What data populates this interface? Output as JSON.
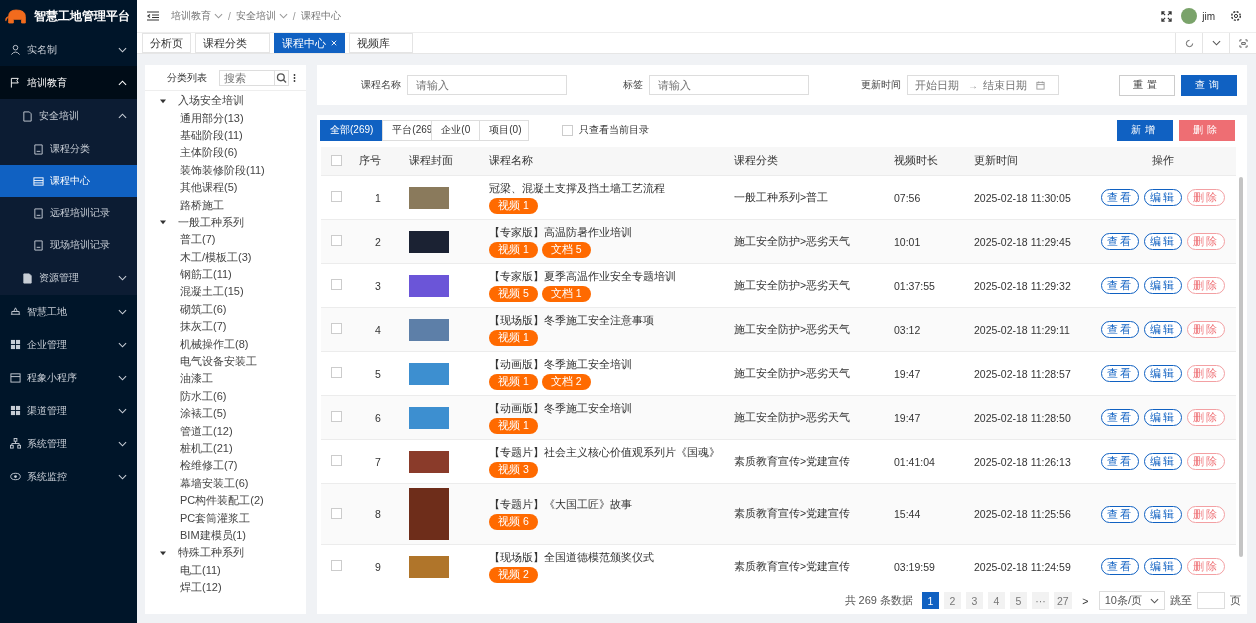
{
  "app": {
    "title": "智慧工地管理平台"
  },
  "sidebar": {
    "items": [
      {
        "label": "实名制",
        "expanded": false
      },
      {
        "label": "培训教育",
        "expanded": true,
        "children": [
          {
            "label": "安全培训",
            "expanded": true,
            "children": [
              {
                "label": "课程分类",
                "selected": false
              },
              {
                "label": "课程中心",
                "selected": true
              },
              {
                "label": "远程培训记录",
                "selected": false
              },
              {
                "label": "现场培训记录",
                "selected": false
              }
            ]
          },
          {
            "label": "资源管理",
            "expanded": false
          }
        ]
      },
      {
        "label": "智慧工地",
        "expanded": false
      },
      {
        "label": "企业管理",
        "expanded": false
      },
      {
        "label": "程象小程序",
        "expanded": false
      },
      {
        "label": "渠道管理",
        "expanded": false
      },
      {
        "label": "系统管理",
        "expanded": false
      },
      {
        "label": "系统监控",
        "expanded": false
      }
    ]
  },
  "breadcrumb": [
    {
      "label": "培训教育",
      "dropdown": true
    },
    {
      "separator": "/",
      "label": "安全培训",
      "dropdown": true
    },
    {
      "separator": "/",
      "label": "课程中心",
      "dropdown": false
    }
  ],
  "user": {
    "name": "jim"
  },
  "tabs": [
    {
      "label": "分析页",
      "selected": false
    },
    {
      "label": "课程分类",
      "selected": false
    },
    {
      "label": "课程中心",
      "selected": true
    },
    {
      "label": "视频库",
      "selected": false
    }
  ],
  "tree": {
    "title": "分类列表",
    "search_placeholder": "搜索",
    "groups": [
      {
        "label": "入场安全培训",
        "expanded": true,
        "children": [
          {
            "label": "通用部分(13)"
          },
          {
            "label": "基础阶段(11)"
          },
          {
            "label": "主体阶段(6)"
          },
          {
            "label": "装饰装修阶段(11)"
          },
          {
            "label": "其他课程(5)"
          },
          {
            "label": "路桥施工"
          }
        ]
      },
      {
        "label": "一般工种系列",
        "expanded": true,
        "children": [
          {
            "label": "普工(7)"
          },
          {
            "label": "木工/模板工(3)"
          },
          {
            "label": "钢筋工(11)"
          },
          {
            "label": "混凝土工(15)"
          },
          {
            "label": "砌筑工(6)"
          },
          {
            "label": "抹灰工(7)"
          },
          {
            "label": "机械操作工(8)"
          },
          {
            "label": "电气设备安装工"
          },
          {
            "label": "油漆工"
          },
          {
            "label": "防水工(6)"
          },
          {
            "label": "涂裱工(5)"
          },
          {
            "label": "管道工(12)"
          },
          {
            "label": "桩机工(21)"
          },
          {
            "label": "检维修工(7)"
          },
          {
            "label": "幕墙安装工(6)"
          },
          {
            "label": "PC构件装配工(2)"
          },
          {
            "label": "PC套筒灌浆工"
          },
          {
            "label": "BIM建模员(1)"
          }
        ]
      },
      {
        "label": "特殊工种系列",
        "expanded": true,
        "children": [
          {
            "label": "电工(11)"
          },
          {
            "label": "焊工(12)"
          }
        ]
      }
    ]
  },
  "filter": {
    "fields": [
      {
        "label": "课程名称",
        "placeholder": "请输入"
      },
      {
        "label": "标签",
        "placeholder": "请输入"
      }
    ],
    "date": {
      "label": "更新时间",
      "start_placeholder": "开始日期",
      "separator": "→",
      "end_placeholder": "结束日期"
    },
    "buttons": [
      {
        "label": "重置",
        "kind": "default"
      },
      {
        "label": "查询",
        "kind": "primary"
      }
    ]
  },
  "source_tabs": [
    {
      "label": "全部(269)",
      "selected": true
    },
    {
      "label": "平台(269",
      "selected": false
    },
    {
      "label": "企业(0",
      "selected": false
    },
    {
      "label": "项目(0)",
      "selected": false
    }
  ],
  "current_only": {
    "label": "只查看当前目录",
    "checked": false
  },
  "actions": [
    {
      "label": "新增",
      "kind": "primary"
    },
    {
      "label": "删除",
      "kind": "danger"
    }
  ],
  "table": {
    "columns": [
      "序号",
      "课程封面",
      "课程名称",
      "课程分类",
      "视频时长",
      "更新时间",
      "操作"
    ],
    "all_checked": false,
    "rows": [
      {
        "checked": false,
        "index": "1",
        "kind": "landscape",
        "title": "冠梁、混凝土支撑及挡土墙工艺流程",
        "tags": [
          "视频 1"
        ],
        "category": "一般工种系列>普工",
        "duration": "07:56",
        "updated": "2025-02-18 11:30:05",
        "actions": [
          {
            "label": "查看",
            "kind": "view"
          },
          {
            "label": "编辑",
            "kind": "edit"
          },
          {
            "label": "删除",
            "kind": "delete"
          }
        ]
      },
      {
        "checked": false,
        "index": "2",
        "kind": "landscape",
        "title": "【专家版】高温防暑作业培训",
        "tags": [
          "视频 1",
          "文档 5"
        ],
        "category": "施工安全防护>恶劣天气",
        "duration": "10:01",
        "updated": "2025-02-18 11:29:45",
        "actions": [
          {
            "label": "查看",
            "kind": "view"
          },
          {
            "label": "编辑",
            "kind": "edit"
          },
          {
            "label": "删除",
            "kind": "delete"
          }
        ]
      },
      {
        "checked": false,
        "index": "3",
        "kind": "landscape",
        "title": "【专家版】夏季高温作业安全专题培训",
        "tags": [
          "视频 5",
          "文档 1"
        ],
        "category": "施工安全防护>恶劣天气",
        "duration": "01:37:55",
        "updated": "2025-02-18 11:29:32",
        "actions": [
          {
            "label": "查看",
            "kind": "view"
          },
          {
            "label": "编辑",
            "kind": "edit"
          },
          {
            "label": "删除",
            "kind": "delete"
          }
        ]
      },
      {
        "checked": false,
        "index": "4",
        "kind": "landscape",
        "title": "【现场版】冬季施工安全注意事项",
        "tags": [
          "视频 1"
        ],
        "category": "施工安全防护>恶劣天气",
        "duration": "03:12",
        "updated": "2025-02-18 11:29:11",
        "actions": [
          {
            "label": "查看",
            "kind": "view"
          },
          {
            "label": "编辑",
            "kind": "edit"
          },
          {
            "label": "删除",
            "kind": "delete"
          }
        ]
      },
      {
        "checked": false,
        "index": "5",
        "kind": "landscape",
        "title": "【动画版】冬季施工安全培训",
        "tags": [
          "视频 1",
          "文档 2"
        ],
        "category": "施工安全防护>恶劣天气",
        "duration": "19:47",
        "updated": "2025-02-18 11:28:57",
        "actions": [
          {
            "label": "查看",
            "kind": "view"
          },
          {
            "label": "编辑",
            "kind": "edit"
          },
          {
            "label": "删除",
            "kind": "delete"
          }
        ]
      },
      {
        "checked": false,
        "index": "6",
        "kind": "landscape",
        "title": "【动画版】冬季施工安全培训",
        "tags": [
          "视频 1"
        ],
        "category": "施工安全防护>恶劣天气",
        "duration": "19:47",
        "updated": "2025-02-18 11:28:50",
        "actions": [
          {
            "label": "查看",
            "kind": "view"
          },
          {
            "label": "编辑",
            "kind": "edit"
          },
          {
            "label": "删除",
            "kind": "delete"
          }
        ]
      },
      {
        "checked": false,
        "index": "7",
        "kind": "landscape",
        "title": "【专题片】社会主义核心价值观系列片《国魂》",
        "tags": [
          "视频 3"
        ],
        "category": "素质教育宣传>党建宣传",
        "duration": "01:41:04",
        "updated": "2025-02-18 11:26:13",
        "actions": [
          {
            "label": "查看",
            "kind": "view"
          },
          {
            "label": "编辑",
            "kind": "edit"
          },
          {
            "label": "删除",
            "kind": "delete"
          }
        ]
      },
      {
        "checked": false,
        "index": "8",
        "kind": "portrait",
        "title": "【专题片】《大国工匠》故事",
        "tags": [
          "视频 6"
        ],
        "category": "素质教育宣传>党建宣传",
        "duration": "15:44",
        "updated": "2025-02-18 11:25:56",
        "actions": [
          {
            "label": "查看",
            "kind": "view"
          },
          {
            "label": "编辑",
            "kind": "edit"
          },
          {
            "label": "删除",
            "kind": "delete"
          }
        ]
      },
      {
        "checked": false,
        "index": "9",
        "kind": "landscape",
        "title": "【现场版】全国道德模范颁奖仪式",
        "tags": [
          "视频 2"
        ],
        "category": "素质教育宣传>党建宣传",
        "duration": "03:19:59",
        "updated": "2025-02-18 11:24:59",
        "actions": [
          {
            "label": "查看",
            "kind": "view"
          },
          {
            "label": "编辑",
            "kind": "edit"
          },
          {
            "label": "删除",
            "kind": "delete"
          }
        ]
      }
    ]
  },
  "pagination": {
    "total": "共 269 条数据",
    "pages": [
      {
        "label": "1",
        "selected": true
      },
      {
        "label": "2",
        "selected": false
      },
      {
        "label": "3",
        "selected": false
      },
      {
        "label": "4",
        "selected": false
      },
      {
        "label": "5",
        "selected": false
      },
      {
        "label": "···",
        "selected": false
      },
      {
        "label": "27",
        "selected": false
      }
    ],
    "next": ">",
    "page_size": "10条/页",
    "jump_label": "跳至",
    "jump_suffix": "页"
  }
}
